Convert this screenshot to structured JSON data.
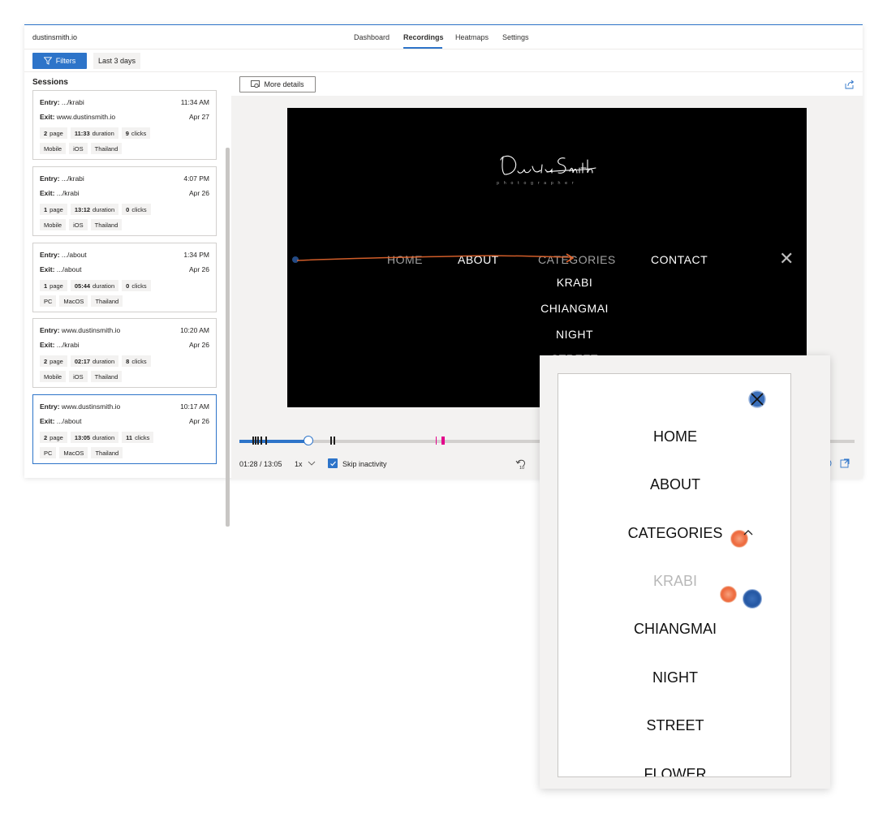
{
  "app": {
    "brand": "dustinsmith.io",
    "tabs": [
      {
        "label": "Dashboard"
      },
      {
        "label": "Recordings"
      },
      {
        "label": "Heatmaps"
      },
      {
        "label": "Settings"
      }
    ],
    "active_tab": "Recordings",
    "accent": "#2d74c9"
  },
  "filterbar": {
    "filters_label": "Filters",
    "range_label": "Last 3 days"
  },
  "sessions": {
    "title": "Sessions",
    "items": [
      {
        "entry_label": "Entry:",
        "entry": " .../krabi",
        "time": "11:34 AM",
        "exit_label": "Exit:",
        "exit": " www.dustinsmith.io",
        "date": "Apr 27",
        "pages_n": "2",
        "pages_u": "page",
        "duration_n": "11:33",
        "duration_u": "duration",
        "clicks_n": "9",
        "clicks_u": "clicks",
        "device": "Mobile",
        "os": "iOS",
        "country": "Thailand"
      },
      {
        "entry_label": "Entry:",
        "entry": " .../krabi",
        "time": "4:07 PM",
        "exit_label": "Exit:",
        "exit": " .../krabi",
        "date": "Apr 26",
        "pages_n": "1",
        "pages_u": "page",
        "duration_n": "13:12",
        "duration_u": "duration",
        "clicks_n": "0",
        "clicks_u": "clicks",
        "device": "Mobile",
        "os": "iOS",
        "country": "Thailand"
      },
      {
        "entry_label": "Entry:",
        "entry": " .../about",
        "time": "1:34 PM",
        "exit_label": "Exit:",
        "exit": " .../about",
        "date": "Apr 26",
        "pages_n": "1",
        "pages_u": "page",
        "duration_n": "05:44",
        "duration_u": "duration",
        "clicks_n": "0",
        "clicks_u": "clicks",
        "device": "PC",
        "os": "MacOS",
        "country": "Thailand"
      },
      {
        "entry_label": "Entry:",
        "entry": " www.dustinsmith.io",
        "time": "10:20 AM",
        "exit_label": "Exit:",
        "exit": " .../krabi",
        "date": "Apr 26",
        "pages_n": "2",
        "pages_u": "page",
        "duration_n": "02:17",
        "duration_u": "duration",
        "clicks_n": "8",
        "clicks_u": "clicks",
        "device": "Mobile",
        "os": "iOS",
        "country": "Thailand"
      },
      {
        "entry_label": "Entry:",
        "entry": " www.dustinsmith.io",
        "time": "10:17 AM",
        "exit_label": "Exit:",
        "exit": " .../about",
        "date": "Apr 26",
        "pages_n": "2",
        "pages_u": "page",
        "duration_n": "13:05",
        "duration_u": "duration",
        "clicks_n": "11",
        "clicks_u": "clicks",
        "device": "PC",
        "os": "MacOS",
        "country": "Thailand"
      }
    ]
  },
  "player": {
    "more_details_label": "More details",
    "site": {
      "logo_script": "Dustin Smith",
      "logo_sub": "photographer",
      "nav": [
        "HOME",
        "ABOUT",
        "CATEGORIES",
        "CONTACT"
      ],
      "submenu": [
        "KRABI",
        "CHIANGMAI",
        "NIGHT",
        "STREET"
      ],
      "close": "✕"
    },
    "time_display": "01:28 / 13:05",
    "progress": 0.112,
    "speed": "1x",
    "skip_inactivity_label": "Skip inactivity",
    "skip_inactivity_checked": true,
    "rewind_label": "10"
  },
  "mobile": {
    "close": "✕",
    "menu": [
      "HOME",
      "ABOUT",
      "CATEGORIES",
      "KRABI",
      "CHIANGMAI",
      "NIGHT",
      "STREET",
      "FLOWER"
    ]
  }
}
